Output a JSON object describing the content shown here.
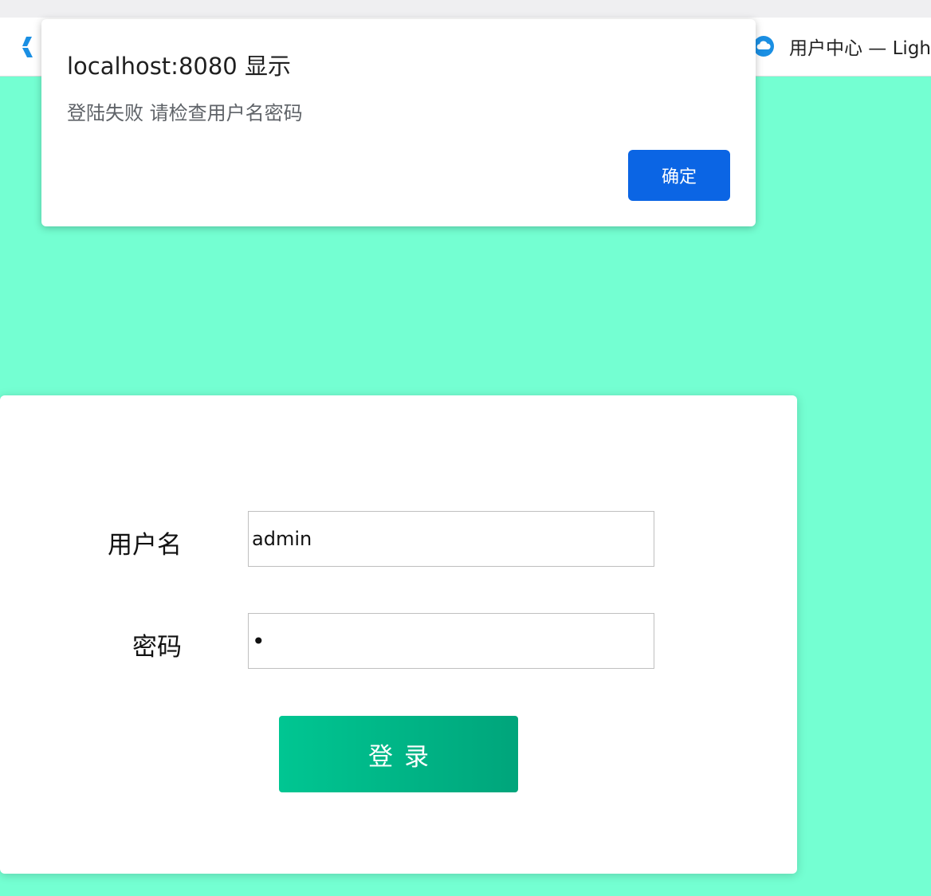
{
  "browser": {
    "tab_title": "用户中心 — Ligh"
  },
  "alert": {
    "title": "localhost:8080 显示",
    "message": "登陆失败 请检查用户名密码",
    "ok_label": "确定"
  },
  "login": {
    "username_label": "用户名",
    "username_value": "admin",
    "password_label": "密码",
    "password_value": "•",
    "submit_label": "登录"
  },
  "colors": {
    "page_background": "#74ffd2",
    "alert_button": "#0b65e4",
    "login_button_start": "#00c692",
    "login_button_end": "#00a57b",
    "cloud_icon": "#1a8fe3"
  },
  "icons": {
    "left_bookmark": "bookmark-icon",
    "tab_favicon": "cloud-icon"
  }
}
